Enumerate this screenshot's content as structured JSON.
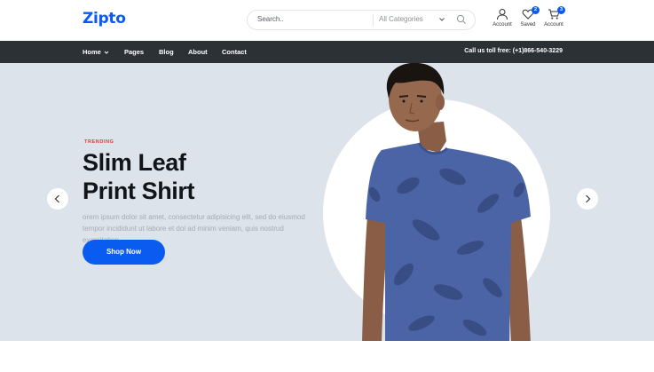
{
  "header": {
    "logo": "Zipto",
    "search": {
      "placeholder": "Search..",
      "category": "All Categories"
    },
    "icons": [
      {
        "name": "user-icon",
        "label": "Account",
        "badge": null
      },
      {
        "name": "heart-icon",
        "label": "Saved",
        "badge": "2"
      },
      {
        "name": "cart-icon",
        "label": "Account",
        "badge": "3"
      }
    ]
  },
  "nav": {
    "items": [
      {
        "label": "Home",
        "dropdown": true
      },
      {
        "label": "Pages",
        "dropdown": false
      },
      {
        "label": "Blog",
        "dropdown": false
      },
      {
        "label": "About",
        "dropdown": false
      },
      {
        "label": "Contact",
        "dropdown": false
      }
    ],
    "call": "Call us toll free: (+1)866-540-3229"
  },
  "hero": {
    "tag": "TRENDING",
    "title_line1": "Slim Leaf",
    "title_line2": "Print Shirt",
    "description": "orem ipsum dolor sit amet, consectetur adipisicing elit, sed do eiusmod tempor incididunt ut labore et dol ad minim veniam, quis nostrud exercitation",
    "cta": "Shop Now"
  },
  "colors": {
    "brand": "#0a5bf0",
    "nav_bg": "#2c3136",
    "hero_bg": "#dde3ea",
    "tag": "#e53935",
    "shirt": "#4a64a6"
  }
}
